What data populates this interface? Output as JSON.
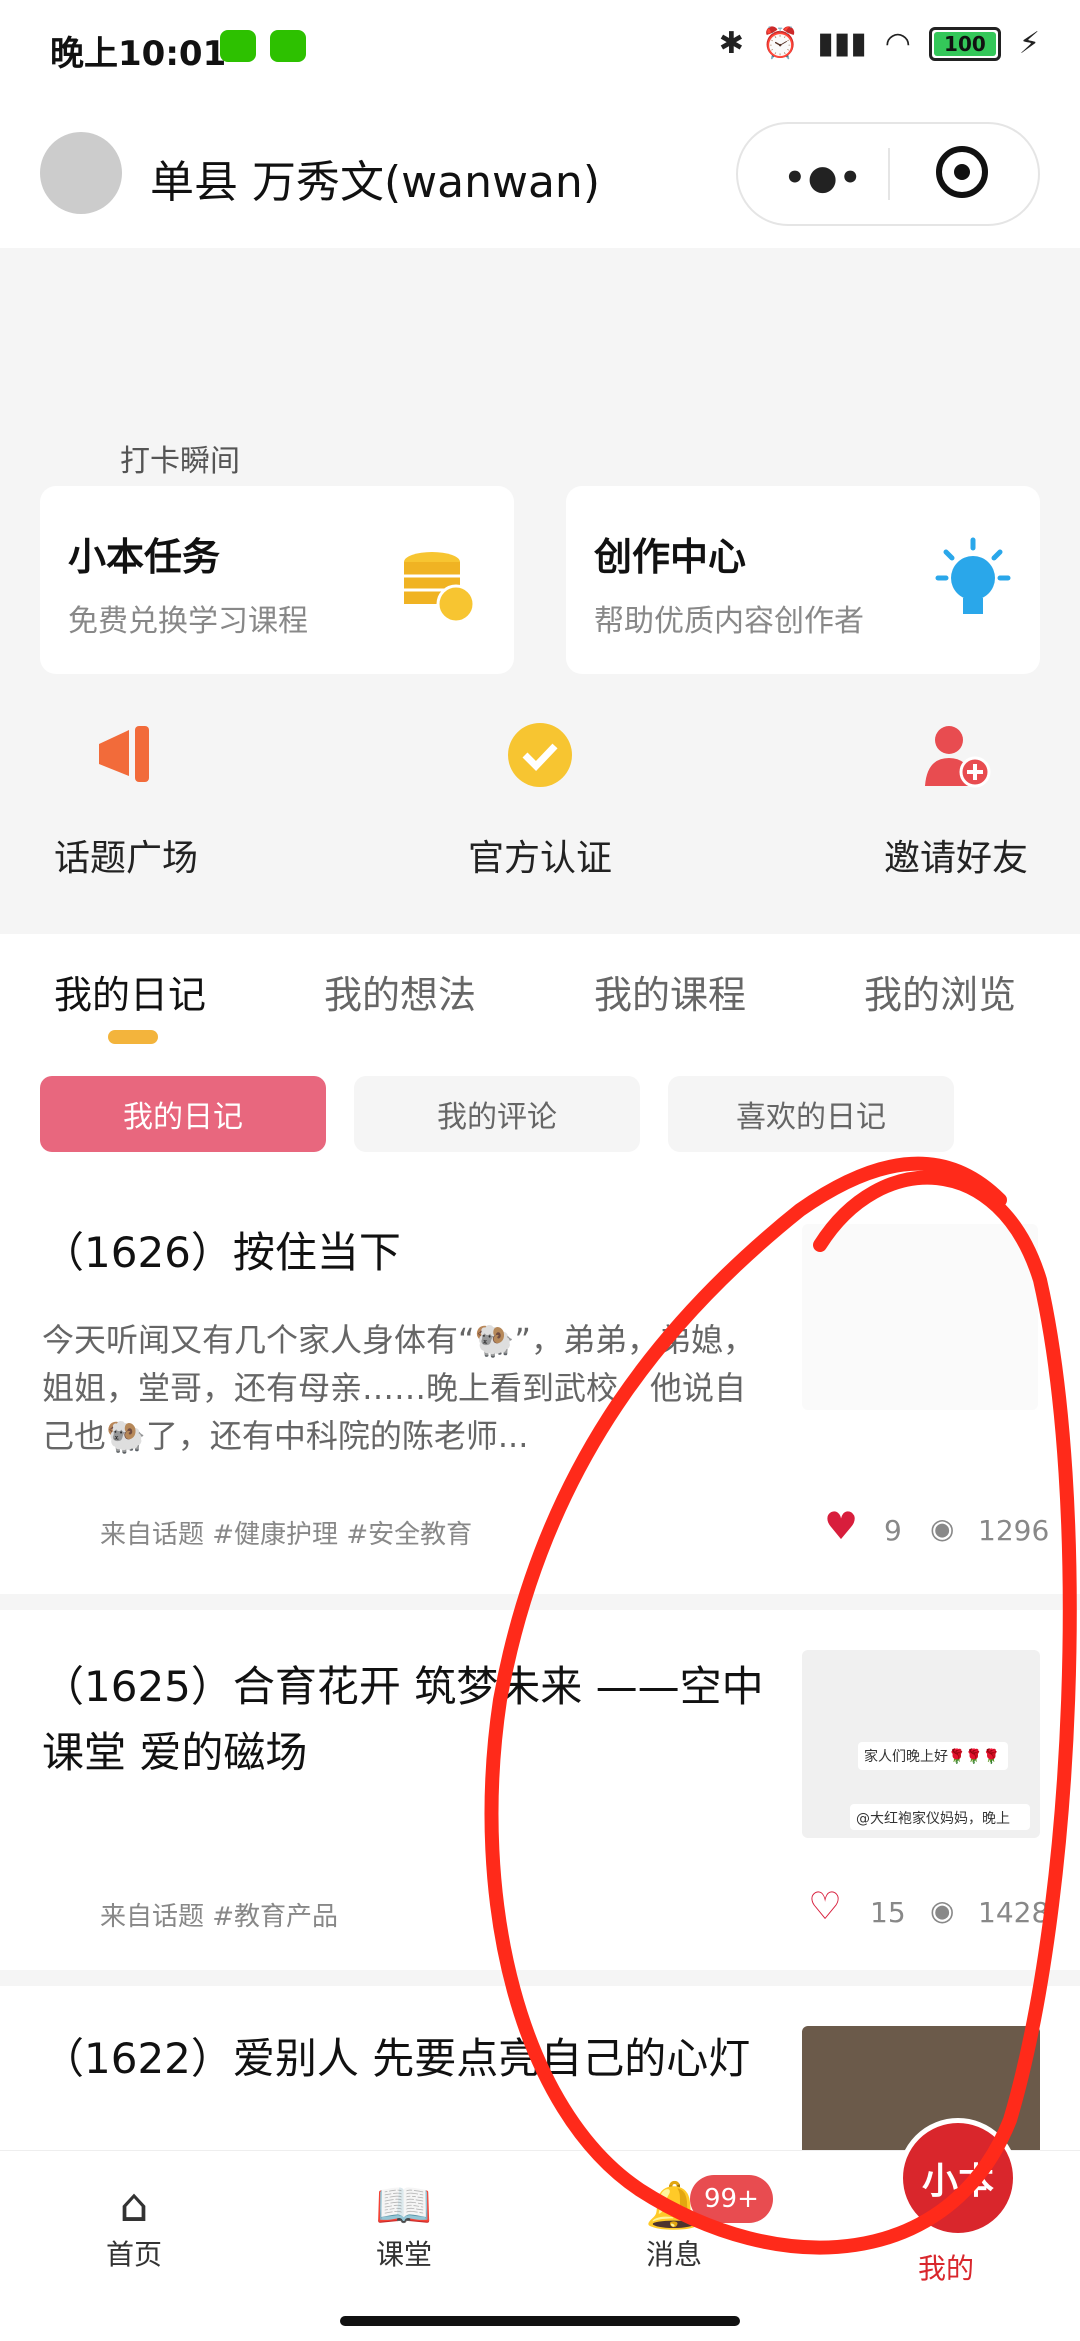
{
  "status": {
    "time": "晚上10:01",
    "battery": "100"
  },
  "header": {
    "name": "单县 万秀文(wanwan)"
  },
  "section": {
    "title": "打卡瞬间"
  },
  "cards": [
    {
      "title": "小本任务",
      "subtitle": "免费兑换学习课程",
      "icon": "coins-icon"
    },
    {
      "title": "创作中心",
      "subtitle": "帮助优质内容创作者",
      "icon": "lightbulb-icon"
    }
  ],
  "quick_links": [
    {
      "label": "话题广场",
      "icon": "megaphone-icon"
    },
    {
      "label": "官方认证",
      "icon": "verified-badge-icon"
    },
    {
      "label": "邀请好友",
      "icon": "add-friend-icon"
    }
  ],
  "tabs": [
    "我的日记",
    "我的想法",
    "我的课程",
    "我的浏览"
  ],
  "subtabs": [
    "我的日记",
    "我的评论",
    "喜欢的日记"
  ],
  "posts": [
    {
      "title": "（1626）按住当下",
      "excerpt": "今天听闻又有几个家人身体有“🐏”，弟弟，弟媳，姐姐，堂哥，还有母亲……晚上看到武校，他说自己也🐏了，还有中科院的陈老师...",
      "tags": "来自话题  #健康护理  #安全教育",
      "likes": "9",
      "views": "1296"
    },
    {
      "title": "（1625）合育花开 筑梦未来 ——空中课堂 爱的磁场",
      "excerpt": "",
      "tags": "来自话题  #教育产品",
      "likes": "15",
      "views": "1428"
    },
    {
      "title": "（1622）爱别人 先要点亮自己的心灯",
      "excerpt": "",
      "tags": "",
      "likes": "",
      "views": ""
    }
  ],
  "thumb_texts": [
    "家人们晚上好🌹🌹🌹",
    "@大红袍家仪妈妈，晚上"
  ],
  "nav": [
    {
      "label": "首页",
      "icon": "home-icon"
    },
    {
      "label": "课堂",
      "icon": "book-icon"
    },
    {
      "label": "消息",
      "icon": "bell-icon",
      "badge": "99+"
    },
    {
      "label": "我的",
      "icon": "profile-icon"
    }
  ],
  "fab_label": "小本",
  "colors": {
    "accent": "#e8677e",
    "like": "#d81e3c",
    "annotation": "#ff2a1a"
  }
}
